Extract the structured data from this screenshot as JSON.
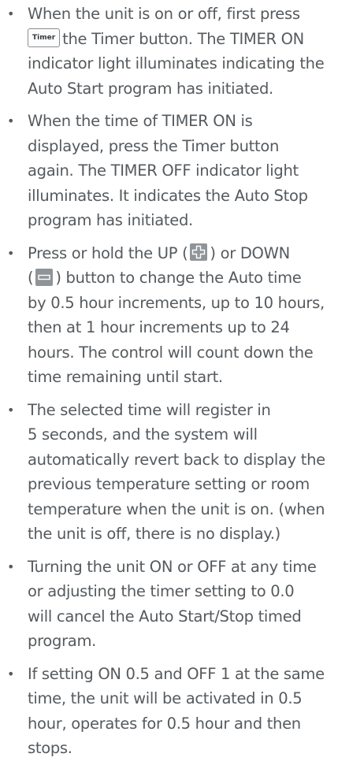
{
  "bullet_glyph": "•",
  "items": [
    {
      "lines": [
        "When the unit is on or off, first press",
        "the Timer button. The TIMER ON",
        "indicator light illuminates indicating the",
        "Auto Start program has initiated."
      ],
      "timer_key_label": "Timer"
    },
    {
      "lines": [
        "When the time of TIMER ON is",
        "displayed, press the Timer button",
        "again. The TIMER OFF indicator light",
        "illuminates. It indicates the Auto Stop",
        "program has initiated."
      ]
    },
    {
      "line1_before": "Press or hold the UP (",
      "line1_after": ") or DOWN",
      "line2_before": "(",
      "line2_after": ") button to change the Auto time",
      "up_icon": "plus-icon",
      "down_icon": "minus-icon",
      "lines": [
        "by 0.5 hour increments, up to 10 hours,",
        "then at 1 hour increments up to 24",
        "hours. The control will count down the",
        "time remaining until start."
      ]
    },
    {
      "lines": [
        "The selected time will register in",
        "5 seconds, and the system will",
        "automatically revert back to display the",
        "previous temperature setting or room",
        "temperature when the unit is on. (when",
        "the unit is off, there is no display.)"
      ]
    },
    {
      "lines": [
        "Turning the unit ON or OFF at any time",
        "or adjusting the timer setting to 0.0",
        "will cancel the Auto Start/Stop timed",
        "program."
      ]
    },
    {
      "lines": [
        "If setting ON 0.5 and OFF 1 at the same",
        "time, the unit will be activated in 0.5",
        "hour, operates for 0.5 hour and then",
        "stops."
      ]
    }
  ],
  "colors": {
    "text": "#555a5e",
    "icon_box": "#8f9498",
    "icon_glyph": "#ffffff",
    "key_border": "#888c90"
  }
}
